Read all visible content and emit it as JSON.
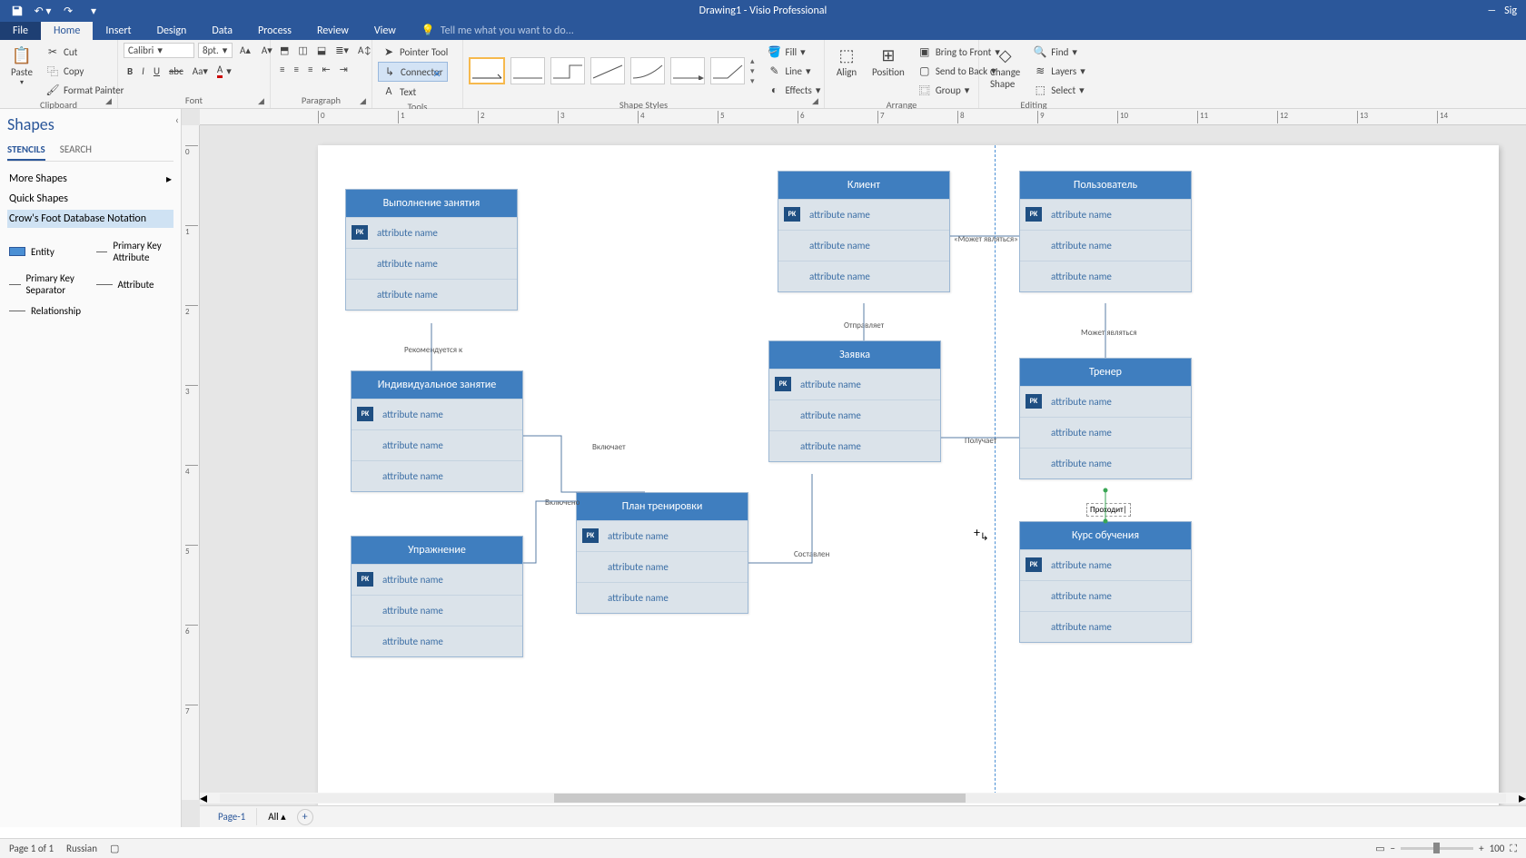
{
  "app": {
    "title": "Drawing1 - Visio Professional",
    "sign": "Sig"
  },
  "qat": {
    "undo_tip": "Undo",
    "redo_tip": "Redo"
  },
  "tabs": [
    "File",
    "Home",
    "Insert",
    "Design",
    "Data",
    "Process",
    "Review",
    "View"
  ],
  "tellme": "Tell me what you want to do...",
  "ribbon": {
    "clipboard": {
      "label": "Clipboard",
      "paste": "Paste",
      "cut": "Cut",
      "copy": "Copy",
      "format_painter": "Format Painter"
    },
    "font": {
      "label": "Font",
      "name": "Calibri",
      "size": "8pt."
    },
    "paragraph": {
      "label": "Paragraph"
    },
    "tools": {
      "label": "Tools",
      "pointer": "Pointer Tool",
      "connector": "Connector",
      "text": "Text"
    },
    "styles": {
      "label": "Shape Styles",
      "fill": "Fill",
      "line": "Line",
      "effects": "Effects"
    },
    "arrange": {
      "label": "Arrange",
      "align": "Align",
      "position": "Position",
      "bring": "Bring to Front",
      "send": "Send to Back",
      "group": "Group"
    },
    "editing": {
      "label": "Editing",
      "change": "Change Shape",
      "find": "Find",
      "layers": "Layers",
      "select": "Select"
    }
  },
  "shapes_panel": {
    "title": "Shapes",
    "tab_stencils": "STENCILS",
    "tab_search": "SEARCH",
    "more": "More Shapes",
    "quick": "Quick Shapes",
    "selected": "Crow's Foot Database Notation",
    "items": [
      "Entity",
      "Primary Key Attribute",
      "Primary Key Separator",
      "Attribute",
      "Relationship"
    ]
  },
  "ruler_ticks": [
    0,
    1,
    2,
    3,
    4,
    5,
    6,
    7,
    8,
    9,
    10,
    11,
    12,
    13,
    14
  ],
  "ruler_v": [
    0,
    1,
    2,
    3,
    4,
    5,
    6,
    7
  ],
  "attr": "attribute name",
  "entities": {
    "e1": {
      "title": "Выполнение занятия",
      "rows": 3
    },
    "e2": {
      "title": "Индивидуальное занятие",
      "rows": 3
    },
    "e3": {
      "title": "Упражнение",
      "rows": 3
    },
    "e4": {
      "title": "План тренировки",
      "rows": 3
    },
    "e5": {
      "title": "Клиент",
      "rows": 3
    },
    "e6": {
      "title": "Заявка",
      "rows": 3
    },
    "e7": {
      "title": "Пользователь",
      "rows": 3
    },
    "e8": {
      "title": "Тренер",
      "rows": 3
    },
    "e9": {
      "title": "Курс обучения",
      "rows": 3
    }
  },
  "labels": {
    "rekom": "Рекомендуется к",
    "mozhet": "«Может являться»",
    "otprav": "Отправляет",
    "vkluch": "Включает",
    "vkluch2": "Включено",
    "sostav": "Составлен",
    "poluch": "Получает",
    "mozhet2": "Может являться",
    "prohodit": "Проходит|"
  },
  "pagetabs": {
    "page": "Page-1",
    "all": "All"
  },
  "status": {
    "page": "Page 1 of 1",
    "lang": "Russian",
    "zoom": "100"
  }
}
